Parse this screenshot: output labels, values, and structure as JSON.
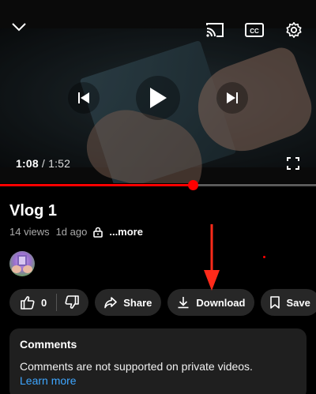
{
  "player": {
    "current_time": "1:08",
    "separator": "/",
    "duration": "1:52",
    "progress_fraction": 0.61,
    "accent_color": "#ff0000",
    "icons": [
      "chevron-down-icon",
      "cast-icon",
      "captions-icon",
      "gear-icon",
      "previous-icon",
      "play-icon",
      "next-icon",
      "fullscreen-icon"
    ]
  },
  "video": {
    "title": "Vlog 1",
    "views": "14 views",
    "age": "1d ago",
    "more_label": "...more"
  },
  "actions": {
    "like_count": "0",
    "share_label": "Share",
    "download_label": "Download",
    "save_label": "Save"
  },
  "comments": {
    "heading": "Comments",
    "message": "Comments are not supported on private videos.",
    "link_label": "Learn more"
  }
}
